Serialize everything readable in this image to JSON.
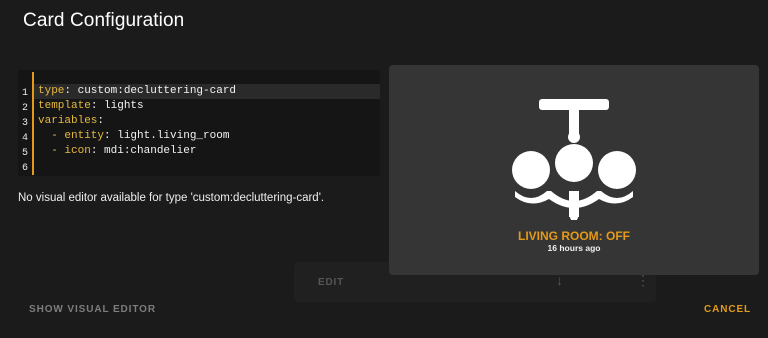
{
  "dialog": {
    "title": "Card Configuration"
  },
  "editor": {
    "line_numbers": [
      "1",
      "2",
      "3",
      "4",
      "5",
      "6"
    ],
    "lines": [
      {
        "key": "type",
        "value": "custom:decluttering-card"
      },
      {
        "key": "template",
        "value": "lights"
      },
      {
        "key": "variables",
        "value": ""
      },
      {
        "key": "entity",
        "value": "light.living_room"
      },
      {
        "key": "icon",
        "value": "mdi:chandelier"
      }
    ]
  },
  "note": "No visual editor available for type 'custom:decluttering-card'.",
  "preview": {
    "icon": "chandelier-icon",
    "name": "LIVING ROOM: OFF",
    "time": "16 hours ago",
    "accent": "#e49a18"
  },
  "ghost_toolbar": {
    "edit_label": "EDIT",
    "arrow_glyph": "↓",
    "more_glyph": "⋮"
  },
  "buttons": {
    "show_visual_editor": "SHOW VISUAL EDITOR",
    "cancel": "CANCEL"
  }
}
